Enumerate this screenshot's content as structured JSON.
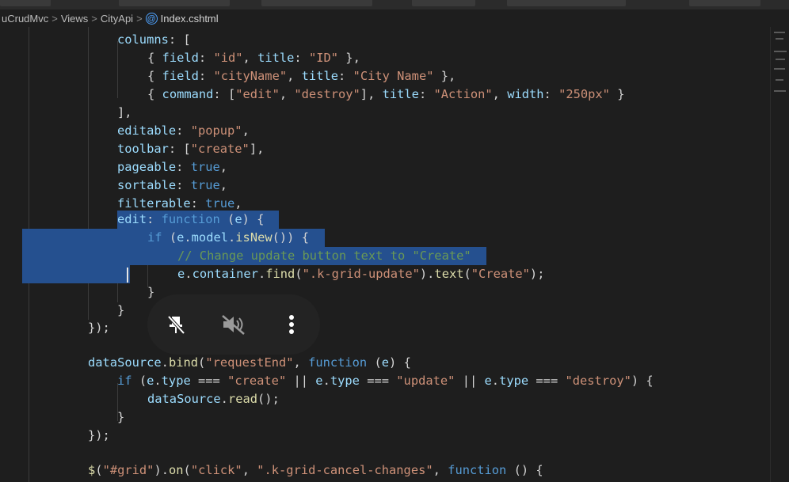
{
  "breadcrumb": {
    "items": [
      "uCrudMvc",
      "Views",
      "CityApi"
    ],
    "file": "Index.cshtml",
    "separator": ">"
  },
  "colors": {
    "background": "#1e1e1e",
    "selection": "#25508f",
    "keyword": "#569cd6",
    "string": "#ce9178",
    "property": "#9cdcfe",
    "comment": "#6a9955"
  },
  "code_lines": [
    "columns: [",
    "{ field: \"id\", title: \"ID\" },",
    "{ field: \"cityName\", title: \"City Name\" },",
    "{ command: [\"edit\", \"destroy\"], title: \"Action\", width: \"250px\" }",
    "],",
    "editable: \"popup\",",
    "toolbar: [\"create\"],",
    "pageable: true,",
    "sortable: true,",
    "filterable: true,",
    "edit: function (e) {",
    "if (e.model.isNew()) {",
    "// Change update button text to \"Create\"",
    "e.container.find(\".k-grid-update\").text(\"Create\");",
    "}",
    "}",
    "});",
    "",
    "dataSource.bind(\"requestEnd\", function (e) {",
    "if (e.type === \"create\" || e.type === \"update\" || e.type === \"destroy\") {",
    "dataSource.read();",
    "}",
    "});",
    "",
    "$(\"#grid\").on(\"click\", \".k-grid-cancel-changes\", function () {"
  ],
  "overlay_controls": {
    "unpin_icon": "unpin-icon",
    "mute_icon": "volume-muted-icon",
    "more_icon": "more-vertical-icon"
  }
}
